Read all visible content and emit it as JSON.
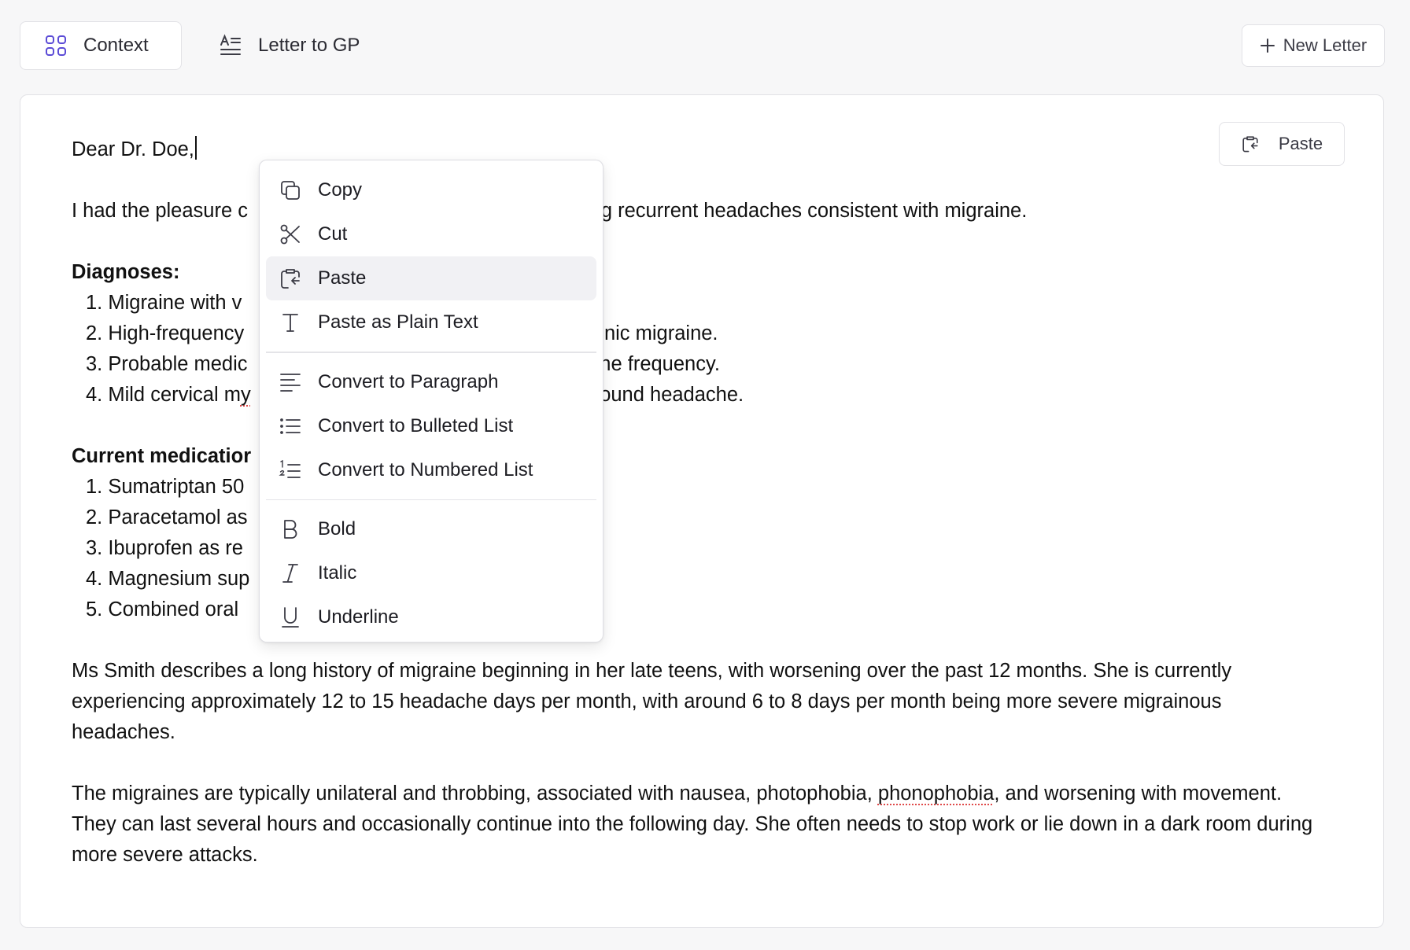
{
  "header": {
    "tabs": [
      {
        "label": "Context",
        "icon": "grid-icon",
        "active": true
      },
      {
        "label": "Letter to GP",
        "icon": "text-format-icon",
        "active": false
      }
    ],
    "new_letter_label": "New Letter",
    "new_letter_icon": "plus-icon"
  },
  "editor": {
    "paste_button_label": "Paste",
    "salutation": "Dear Dr. Doe,",
    "intro_left": "I had the pleasure c",
    "intro_right": "garding recurrent headaches consistent with migraine.",
    "diagnoses_heading": "Diagnoses:",
    "diagnoses": [
      {
        "left": "1. Migraine with v",
        "right": ""
      },
      {
        "left": "2. High-frequency",
        "right": "ronic migraine."
      },
      {
        "left": "3. Probable medic",
        "right": "che frequency."
      },
      {
        "left": "4. Mild cervical m",
        "leftSpell": "y",
        "right": "round headache."
      }
    ],
    "medications_heading": "Current medicatior",
    "medications": [
      "1. Sumatriptan 50",
      "2. Paracetamol as",
      "3. Ibuprofen as re",
      "4. Magnesium sup",
      "5. Combined oral"
    ],
    "paragraph1": "Ms Smith describes a long history of migraine beginning in her late teens, with worsening over the past 12 months. She is currently experiencing approximately 12 to 15 headache days per month, with around 6 to 8 days per month being more severe migrainous headaches.",
    "paragraph2_a": "The migraines are typically unilateral and throbbing, associated with nausea, photophobia, ",
    "paragraph2_spell": "phonophobia",
    "paragraph2_b": ", and worsening with movement. They can last several hours and occasionally continue into the following day. She often needs to stop work or lie down in a dark room during more severe attacks."
  },
  "context_menu": {
    "groups": [
      [
        {
          "label": "Copy",
          "icon": "copy-icon"
        },
        {
          "label": "Cut",
          "icon": "scissors-icon"
        },
        {
          "label": "Paste",
          "icon": "clipboard-paste-icon",
          "highlighted": true
        },
        {
          "label": "Paste as Plain Text",
          "icon": "text-type-icon"
        }
      ],
      [
        {
          "label": "Convert to Paragraph",
          "icon": "paragraph-lines-icon"
        },
        {
          "label": "Convert to Bulleted List",
          "icon": "bulleted-list-icon"
        },
        {
          "label": "Convert to Numbered List",
          "icon": "numbered-list-icon"
        }
      ],
      [
        {
          "label": "Bold",
          "icon": "bold-icon"
        },
        {
          "label": "Italic",
          "icon": "italic-icon"
        },
        {
          "label": "Underline",
          "icon": "underline-icon"
        }
      ]
    ]
  },
  "colors": {
    "accent": "#5b4bd6",
    "menu_highlight": "#f1f1f4",
    "spellcheck": "#e04a4a"
  }
}
